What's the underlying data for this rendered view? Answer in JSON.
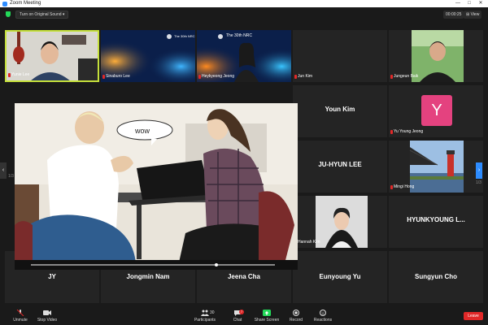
{
  "window": {
    "title": "Zoom Meeting",
    "minimize": "—",
    "maximize": "□",
    "close": "✕"
  },
  "topbar": {
    "audio_button": "Turn on Original Sound ▾",
    "timer": "00:00:25",
    "view_button": "⊞ View"
  },
  "nav": {
    "page_left": "1/3",
    "page_right": "1/3",
    "left_arrow": "‹",
    "right_arrow": "›"
  },
  "participants": [
    {
      "id": "yunie-lee",
      "name": "Yunie Lee"
    },
    {
      "id": "sinaburo-lee",
      "name": "Sinaburo Lee",
      "logo": "The 30th NRC"
    },
    {
      "id": "heykyeong-jeong",
      "name": "Heykyeong Jeong",
      "logo": "The 30th NRC"
    },
    {
      "id": "jun-kim",
      "name": "Jun Kim"
    },
    {
      "id": "jungeun-baik",
      "name": "Jungeun Baik"
    },
    {
      "id": "youn-kim",
      "name": "Youn Kim"
    },
    {
      "id": "yu-young-jeong",
      "name": "Yu Young Jeong",
      "avatar_letter": "Y"
    },
    {
      "id": "ju-hyun-lee",
      "name": "JU-HYUN LEE"
    },
    {
      "id": "mingi-hong",
      "name": "Mingi Hong"
    },
    {
      "id": "hannah-kim",
      "name": "Hannah Kim"
    },
    {
      "id": "hyunkyoung-l",
      "name": "HYUNKYOUNG  L..."
    },
    {
      "id": "jy",
      "name": "JY"
    },
    {
      "id": "jongmin-nam",
      "name": "Jongmin Nam"
    },
    {
      "id": "jeena-cha",
      "name": "Jeena Cha"
    },
    {
      "id": "eunyoung-yu",
      "name": "Eunyoung Yu"
    },
    {
      "id": "sungyun-cho",
      "name": "Sungyun Cho"
    }
  ],
  "shared": {
    "speech_bubble": "wow"
  },
  "controls": {
    "unmute": "Unmute",
    "stop_video": "Stop Video",
    "participants": "Participants",
    "participants_count": "30",
    "chat": "Chat",
    "chat_badge": "7",
    "share_screen": "Share Screen",
    "record": "Record",
    "reactions": "Reactions",
    "leave": "Leave"
  },
  "colors": {
    "accent_blue": "#2d8cff",
    "active_speaker": "#c5e03b",
    "share_green": "#23d959",
    "leave_red": "#e02828",
    "avatar_pink": "#e4427f"
  }
}
